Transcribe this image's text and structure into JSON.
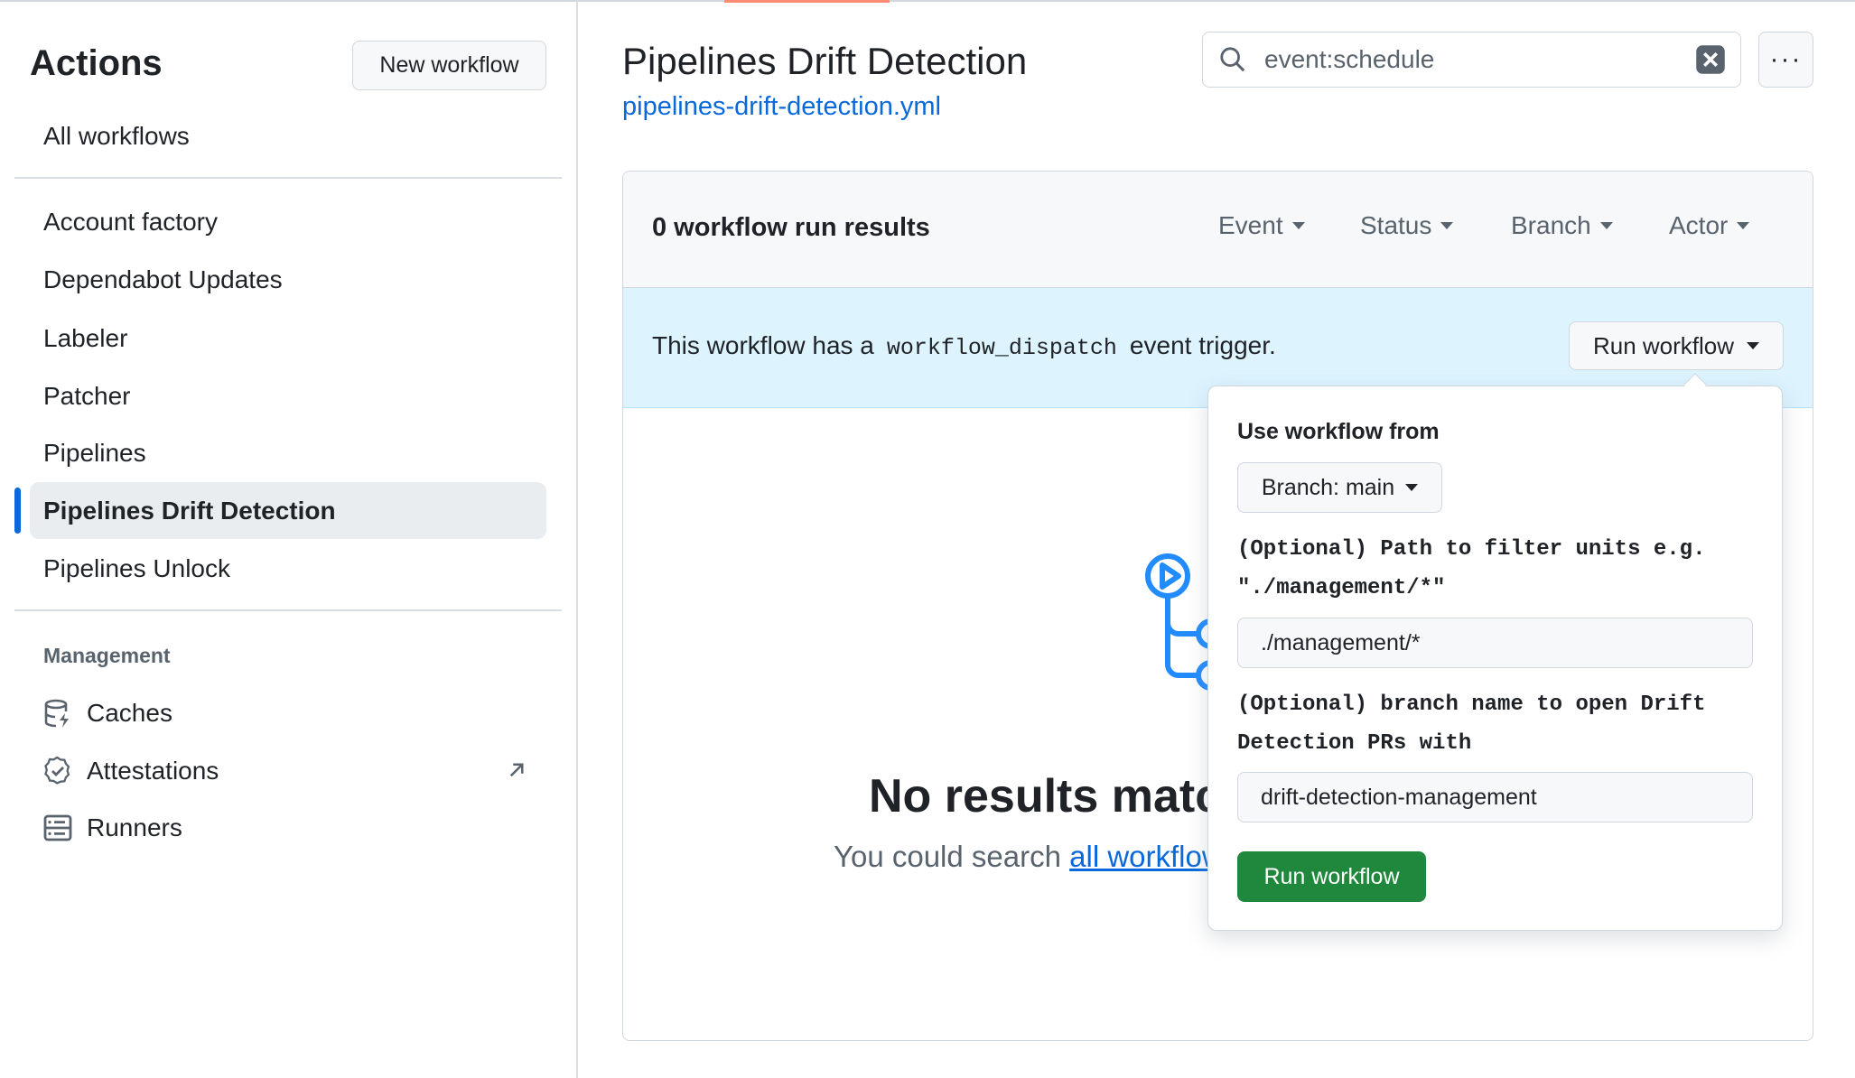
{
  "sidebar": {
    "title": "Actions",
    "new_workflow": "New workflow",
    "all_workflows": "All workflows",
    "workflows": [
      "Account factory",
      "Dependabot Updates",
      "Labeler",
      "Patcher",
      "Pipelines",
      "Pipelines Drift Detection",
      "Pipelines Unlock"
    ],
    "selected": "Pipelines Drift Detection",
    "management_heading": "Management",
    "management": [
      {
        "label": "Caches",
        "icon": "database-icon"
      },
      {
        "label": "Attestations",
        "icon": "verified-icon",
        "external": true
      },
      {
        "label": "Runners",
        "icon": "server-icon"
      }
    ]
  },
  "header": {
    "title": "Pipelines Drift Detection",
    "file_link": "pipelines-drift-detection.yml"
  },
  "search": {
    "value": "event:schedule"
  },
  "results": {
    "count_label": "0 workflow run results",
    "filters": [
      "Event",
      "Status",
      "Branch",
      "Actor"
    ],
    "banner_prefix": "This workflow has a",
    "banner_code": "workflow_dispatch",
    "banner_suffix": "event trigger.",
    "run_button": "Run workflow",
    "empty_title": "No results matched your search.",
    "empty_prefix": "You could search",
    "empty_link": "all workflows"
  },
  "popover": {
    "heading": "Use workflow from",
    "branch_button": "Branch: main",
    "input1_label_line1": "(Optional) Path to filter units e.g.",
    "input1_label_line2": "\"./management/*\"",
    "input1_value": "./management/*",
    "input2_label_line1": "(Optional) branch name to open Drift",
    "input2_label_line2": "Detection PRs with",
    "input2_value": "drift-detection-management",
    "submit": "Run workflow"
  },
  "colors": {
    "accent": "#0969da",
    "success": "#1f883d",
    "banner": "#ddf4ff"
  }
}
